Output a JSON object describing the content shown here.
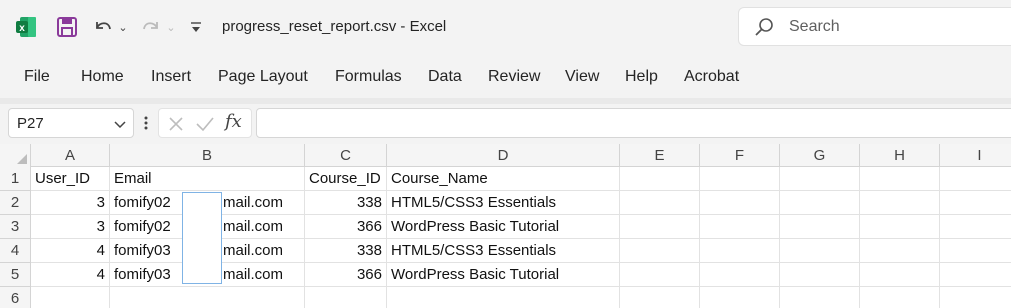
{
  "titlebar": {
    "app_icon": "excel-icon",
    "save_icon": "save-icon",
    "undo_icon": "undo-icon",
    "redo_icon": "redo-icon",
    "qat_icon": "customize-qat-icon",
    "document_title": "progress_reset_report.csv  -  Excel",
    "search_placeholder": "Search",
    "brand_color": "#217346"
  },
  "menu": {
    "tabs": [
      "File",
      "Home",
      "Insert",
      "Page Layout",
      "Formulas",
      "Data",
      "Review",
      "View",
      "Help",
      "Acrobat"
    ]
  },
  "formula_bar": {
    "name_box": "P27",
    "fx_label": "fx",
    "formula": ""
  },
  "sheet": {
    "columns": [
      "A",
      "B",
      "C",
      "D",
      "E",
      "F",
      "G",
      "H",
      "I"
    ],
    "rows": [
      "1",
      "2",
      "3",
      "4",
      "5",
      "6"
    ],
    "cells": [
      [
        "User_ID",
        "Email",
        "Course_ID",
        "Course_Name"
      ],
      [
        "3",
        "fomify02",
        "mail.com",
        "338",
        "HTML5/CSS3 Essentials"
      ],
      [
        "3",
        "fomify02",
        "mail.com",
        "366",
        "WordPress Basic Tutorial"
      ],
      [
        "4",
        "fomify03",
        "mail.com",
        "338",
        "HTML5/CSS3 Essentials"
      ],
      [
        "4",
        "fomify03",
        "mail.com",
        "366",
        "WordPress Basic Tutorial"
      ]
    ]
  }
}
